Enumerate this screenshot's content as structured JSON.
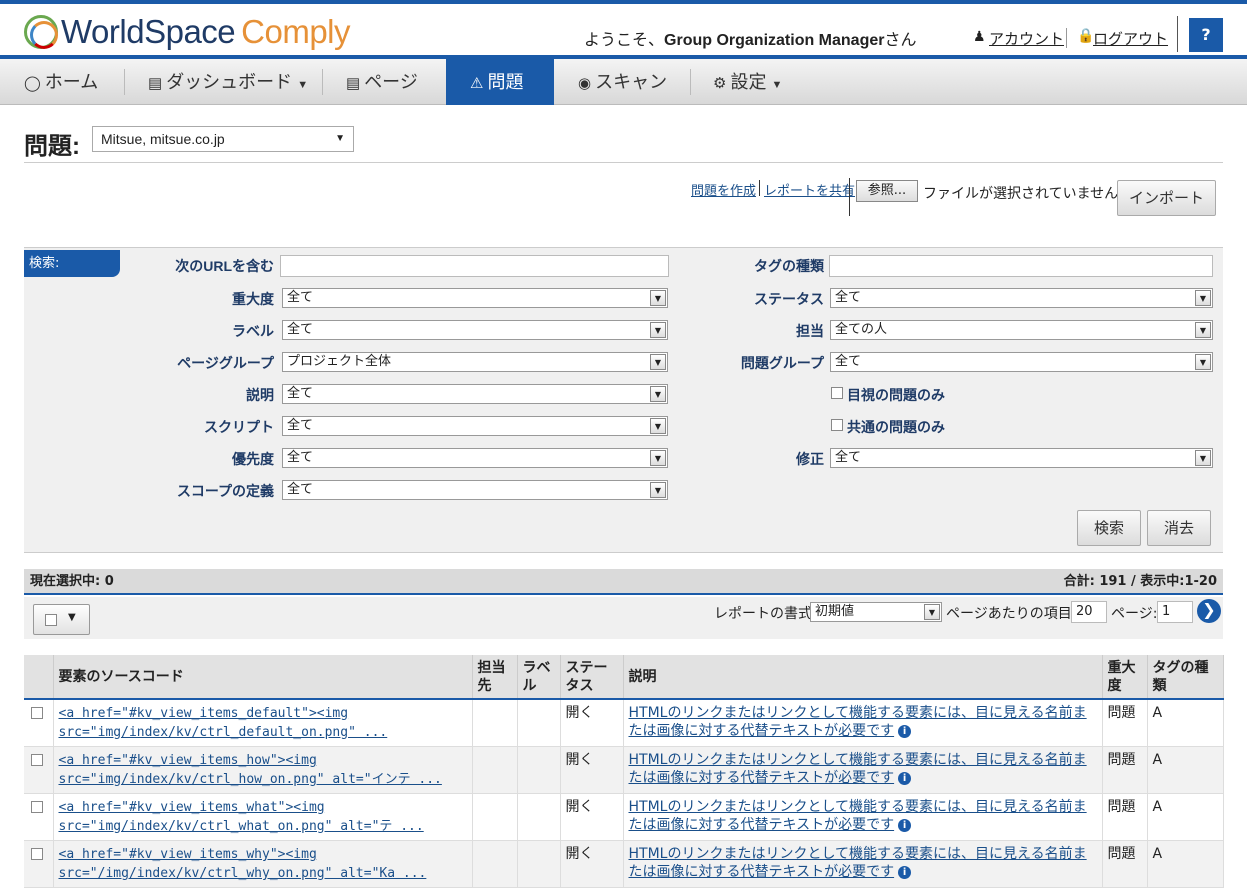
{
  "header": {
    "logo_world": "WorldSpace",
    "logo_comply": "Comply",
    "welcome_prefix": "ようこそ、",
    "welcome_user": "Group Organization Manager",
    "welcome_suffix": "さん",
    "account_link": "アカウント",
    "logout_link": "ログアウト",
    "help_label": "?"
  },
  "nav": {
    "items": [
      {
        "label": "ホーム",
        "icon": "globe-icon"
      },
      {
        "label": "ダッシュボード",
        "icon": "dashboard-icon"
      },
      {
        "label": "ページ",
        "icon": "page-icon"
      },
      {
        "label": "問題",
        "icon": "warning-icon"
      },
      {
        "label": "スキャン",
        "icon": "scan-icon"
      },
      {
        "label": "設定",
        "icon": "gear-icon"
      }
    ],
    "active_color": "#1a5aa8"
  },
  "page": {
    "title": "問題:",
    "site_select": "Mitsue, mitsue.co.jp",
    "create_issue": "問題を作成",
    "share_report": "レポートを共有",
    "browse_button": "参照...",
    "no_file": "ファイルが選択されていません。",
    "import_button": "インポート"
  },
  "search": {
    "tab_label": "検索:",
    "left": [
      {
        "label": "次のURLを含む",
        "value": ""
      },
      {
        "label": "重大度",
        "value": "全て"
      },
      {
        "label": "ラベル",
        "value": "全て"
      },
      {
        "label": "ページグループ",
        "value": "プロジェクト全体"
      },
      {
        "label": "説明",
        "value": "全て"
      },
      {
        "label": "スクリプト",
        "value": "全て"
      },
      {
        "label": "優先度",
        "value": "全て"
      },
      {
        "label": "スコープの定義",
        "value": "全て"
      }
    ],
    "right": [
      {
        "label": "タグの種類",
        "value": ""
      },
      {
        "label": "ステータス",
        "value": "全て"
      },
      {
        "label": "担当",
        "value": "全ての人"
      },
      {
        "label": "問題グループ",
        "value": "全て"
      },
      {
        "label": "修正",
        "value": "全て"
      }
    ],
    "checkbox_visual": "目視の問題のみ",
    "checkbox_common": "共通の問題のみ",
    "search_button": "検索",
    "clear_button": "消去"
  },
  "results": {
    "selected": "現在選択中: 0",
    "total": "合計: 191 / 表示中:1-20",
    "report_format_label": "レポートの書式",
    "report_format_value": "初期値",
    "per_page_label": "ページあたりの項目:",
    "per_page_value": "20",
    "page_label": "ページ:",
    "page_value": "1"
  },
  "table": {
    "columns": [
      "要素のソースコード",
      "担当先",
      "ラベル",
      "ステータス",
      "説明",
      "重大度",
      "タグの種類"
    ],
    "rows": [
      {
        "code": "<a href=\"#kv_view_items_default\"><img src=\"img/index/kv/ctrl_default_on.png\" ...",
        "assignee": "",
        "label": "",
        "status": "開く",
        "desc": "HTMLのリンクまたはリンクとして機能する要素には、目に見える名前または画像に対する代替テキストが必要です",
        "severity": "問題",
        "tag": "A"
      },
      {
        "code": "<a href=\"#kv_view_items_how\"><img src=\"img/index/kv/ctrl_how_on.png\" alt=\"インテ ...",
        "assignee": "",
        "label": "",
        "status": "開く",
        "desc": "HTMLのリンクまたはリンクとして機能する要素には、目に見える名前または画像に対する代替テキストが必要です",
        "severity": "問題",
        "tag": "A"
      },
      {
        "code": "<a href=\"#kv_view_items_what\"><img src=\"img/index/kv/ctrl_what_on.png\" alt=\"テ ...",
        "assignee": "",
        "label": "",
        "status": "開く",
        "desc": "HTMLのリンクまたはリンクとして機能する要素には、目に見える名前または画像に対する代替テキストが必要です",
        "severity": "問題",
        "tag": "A"
      },
      {
        "code": "<a href=\"#kv_view_items_why\"><img src=\"/img/index/kv/ctrl_why_on.png\" alt=\"Ka ...",
        "assignee": "",
        "label": "",
        "status": "開く",
        "desc": "HTMLのリンクまたはリンクとして機能する要素には、目に見える名前または画像に対する代替テキストが必要です",
        "severity": "問題",
        "tag": "A"
      }
    ]
  }
}
